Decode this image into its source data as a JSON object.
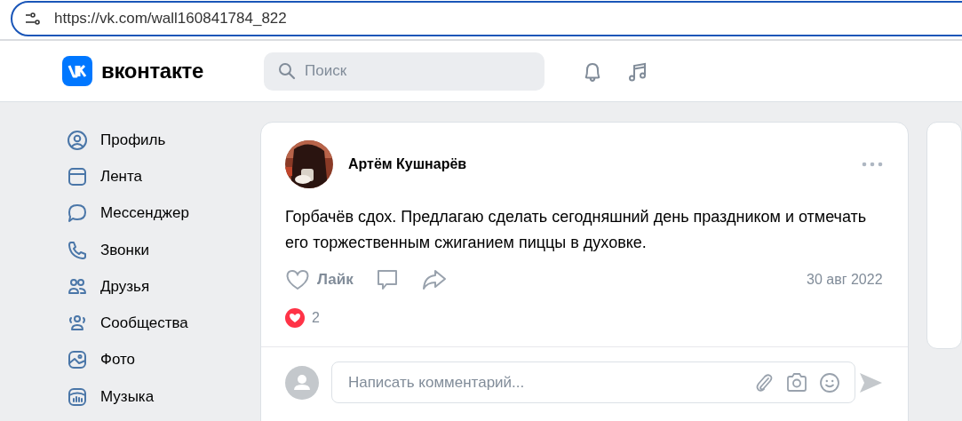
{
  "browser": {
    "url": "https://vk.com/wall160841784_822"
  },
  "header": {
    "brand": "вконтакте",
    "search": {
      "placeholder": "Поиск"
    }
  },
  "sidebar": {
    "items": [
      {
        "label": "Профиль"
      },
      {
        "label": "Лента"
      },
      {
        "label": "Мессенджер"
      },
      {
        "label": "Звонки"
      },
      {
        "label": "Друзья"
      },
      {
        "label": "Сообщества"
      },
      {
        "label": "Фото"
      },
      {
        "label": "Музыка"
      }
    ]
  },
  "post": {
    "author": "Артём Кушнарёв",
    "text": "Горбачёв сдох. Предлагаю сделать сегодняшний день праздником и отмечать его торжественным сжиганием пиццы в духовке.",
    "like_label": "Лайк",
    "liked": false,
    "date": "30 авг 2022",
    "reactions_count": "2",
    "comment": {
      "placeholder": "Написать комментарий..."
    }
  }
}
